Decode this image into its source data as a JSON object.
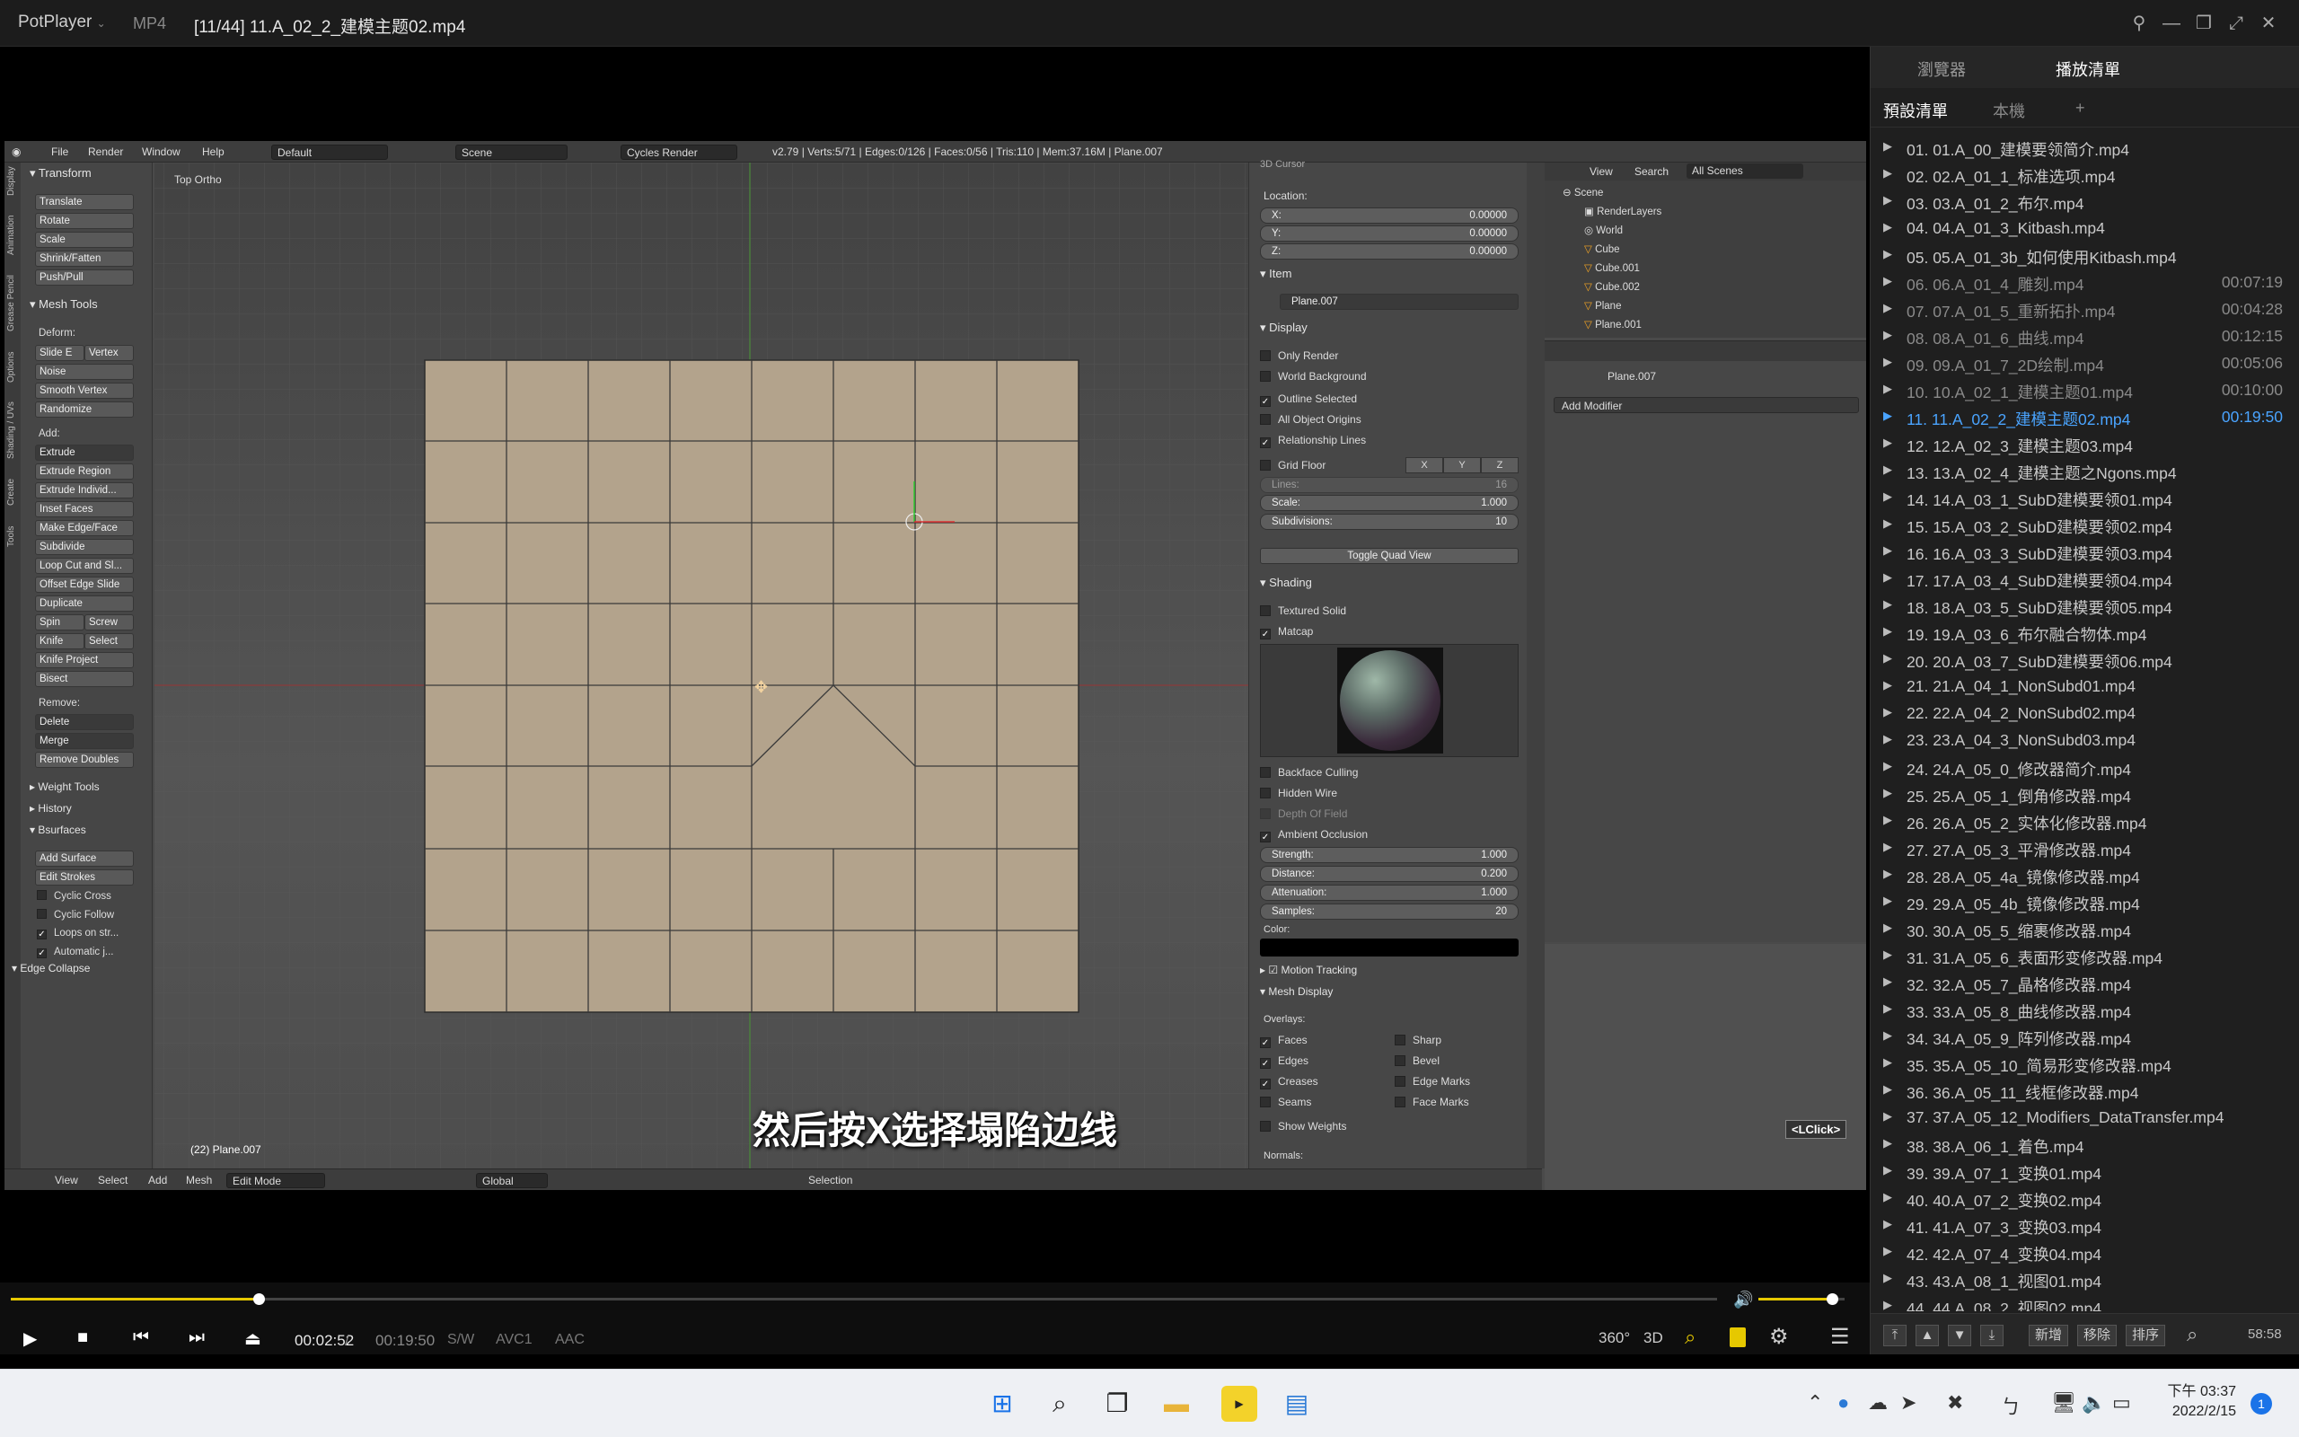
{
  "titlebar": {
    "app_name": "PotPlayer",
    "format": "MP4",
    "file_title": "[11/44] 11.A_02_2_建模主题02.mp4"
  },
  "blender": {
    "info_bar": {
      "menus": [
        "File",
        "Render",
        "Window",
        "Help"
      ],
      "layout": "Default",
      "scene": "Scene",
      "engine": "Cycles Render",
      "stats": "v2.79 | Verts:5/71 | Edges:0/126 | Faces:0/56 | Tris:110 | Mem:37.16M | Plane.007"
    },
    "toolshelf": {
      "transform_title": "Transform",
      "transform_buttons": [
        "Translate",
        "Rotate",
        "Scale",
        "Shrink/Fatten",
        "Push/Pull"
      ],
      "mesh_tools_title": "Mesh Tools",
      "deform_label": "Deform:",
      "slide_edge": "Slide E",
      "vertex": "Vertex",
      "deform_buttons": [
        "Noise",
        "Smooth Vertex",
        "Randomize"
      ],
      "add_label": "Add:",
      "extrude": "Extrude",
      "add_buttons": [
        "Extrude Region",
        "Extrude Individ...",
        "Inset Faces",
        "Make Edge/Face",
        "Subdivide",
        "Loop Cut and Sl...",
        "Offset Edge Slide",
        "Duplicate"
      ],
      "spin": "Spin",
      "screw": "Screw",
      "knife": "Knife",
      "select": "Select",
      "knife_project": "Knife Project",
      "bisect": "Bisect",
      "remove_label": "Remove:",
      "delete": "Delete",
      "merge": "Merge",
      "remove_doubles": "Remove Doubles",
      "weight_tools": "Weight Tools",
      "history": "History",
      "bsurfaces": "Bsurfaces",
      "add_surface": "Add Surface",
      "edit_strokes": "Edit Strokes",
      "cyclic_cross": "Cyclic Cross",
      "cyclic_follow": "Cyclic Follow",
      "loops_on_strokes": "Loops on str...",
      "automatic": "Automatic j...",
      "edge_collapse": "Edge Collapse",
      "vtabs": [
        "Tools",
        "Create",
        "Shading / UVs",
        "Options",
        "Grease Pencil",
        "Animation",
        "Display"
      ]
    },
    "viewport": {
      "view_label": "Top Ortho",
      "object_label": "(22) Plane.007"
    },
    "npanel": {
      "cursor_title": "3D Cursor",
      "location_label": "Location:",
      "x": {
        "label": "X:",
        "value": "0.00000"
      },
      "y": {
        "label": "Y:",
        "value": "0.00000"
      },
      "z": {
        "label": "Z:",
        "value": "0.00000"
      },
      "item_title": "Item",
      "item_name": "Plane.007",
      "display_title": "Display",
      "only_render": "Only Render",
      "world_background": "World Background",
      "outline_selected": "Outline Selected",
      "all_object_origins": "All Object Origins",
      "relationship_lines": "Relationship Lines",
      "grid_floor": "Grid Floor",
      "gx": "X",
      "gy": "Y",
      "gz": "Z",
      "lines": {
        "label": "Lines:",
        "value": "16"
      },
      "scale": {
        "label": "Scale:",
        "value": "1.000"
      },
      "subdivisions": {
        "label": "Subdivisions:",
        "value": "10"
      },
      "toggle_quad": "Toggle Quad View",
      "shading_title": "Shading",
      "textured_solid": "Textured Solid",
      "matcap": "Matcap",
      "backface_culling": "Backface Culling",
      "hidden_wire": "Hidden Wire",
      "depth_of_field": "Depth Of Field",
      "ambient_occlusion": "Ambient Occlusion",
      "strength": {
        "label": "Strength:",
        "value": "1.000"
      },
      "distance": {
        "label": "Distance:",
        "value": "0.200"
      },
      "attenuation": {
        "label": "Attenuation:",
        "value": "1.000"
      },
      "samples": {
        "label": "Samples:",
        "value": "20"
      },
      "color_label": "Color:",
      "motion_tracking": "Motion Tracking",
      "mesh_display": "Mesh Display",
      "overlays": "Overlays:",
      "faces": "Faces",
      "sharp": "Sharp",
      "edges": "Edges",
      "bevel": "Bevel",
      "creases": "Creases",
      "edge_marks": "Edge Marks",
      "seams": "Seams",
      "face_marks": "Face Marks",
      "show_weights": "Show Weights",
      "normals": "Normals:"
    },
    "outliner": {
      "view": "View",
      "search": "Search",
      "filter": "All Scenes",
      "items": [
        "Scene",
        "RenderLayers",
        "World",
        "Cube",
        "Cube.001",
        "Cube.002",
        "Plane",
        "Plane.001"
      ]
    },
    "properties": {
      "object": "Plane.007",
      "add_modifier": "Add Modifier"
    },
    "lower": {
      "lclick": "<LClick>"
    },
    "bottom_bar": {
      "menus": [
        "View",
        "Select",
        "Add",
        "Mesh"
      ],
      "mode": "Edit Mode",
      "orientation": "Global",
      "selection": "Selection"
    }
  },
  "subtitle": "然后按X选择塌陷边线",
  "player": {
    "current_time": "00:02:52",
    "separator": "/",
    "duration": "00:19:50",
    "codecs": [
      "S/W",
      "AVC1",
      "AAC"
    ],
    "right_buttons": [
      "360°",
      "3D"
    ],
    "progress_fraction": 0.145,
    "volume_fraction": 0.85
  },
  "playlist": {
    "tabs": [
      "瀏覽器",
      "播放清單"
    ],
    "subtabs": [
      "預設清單",
      "本機",
      "+"
    ],
    "active_index": 10,
    "items": [
      {
        "name": "01. 01.A_00_建模要领简介.mp4",
        "duration": ""
      },
      {
        "name": "02. 02.A_01_1_标准选项.mp4",
        "duration": ""
      },
      {
        "name": "03. 03.A_01_2_布尔.mp4",
        "duration": ""
      },
      {
        "name": "04. 04.A_01_3_Kitbash.mp4",
        "duration": ""
      },
      {
        "name": "05. 05.A_01_3b_如何使用Kitbash.mp4",
        "duration": ""
      },
      {
        "name": "06. 06.A_01_4_雕刻.mp4",
        "duration": "00:07:19"
      },
      {
        "name": "07. 07.A_01_5_重新拓扑.mp4",
        "duration": "00:04:28"
      },
      {
        "name": "08. 08.A_01_6_曲线.mp4",
        "duration": "00:12:15"
      },
      {
        "name": "09. 09.A_01_7_2D绘制.mp4",
        "duration": "00:05:06"
      },
      {
        "name": "10. 10.A_02_1_建模主题01.mp4",
        "duration": "00:10:00"
      },
      {
        "name": "11. 11.A_02_2_建模主题02.mp4",
        "duration": "00:19:50"
      },
      {
        "name": "12. 12.A_02_3_建模主题03.mp4",
        "duration": ""
      },
      {
        "name": "13. 13.A_02_4_建模主题之Ngons.mp4",
        "duration": ""
      },
      {
        "name": "14. 14.A_03_1_SubD建模要领01.mp4",
        "duration": ""
      },
      {
        "name": "15. 15.A_03_2_SubD建模要领02.mp4",
        "duration": ""
      },
      {
        "name": "16. 16.A_03_3_SubD建模要领03.mp4",
        "duration": ""
      },
      {
        "name": "17. 17.A_03_4_SubD建模要领04.mp4",
        "duration": ""
      },
      {
        "name": "18. 18.A_03_5_SubD建模要领05.mp4",
        "duration": ""
      },
      {
        "name": "19. 19.A_03_6_布尔融合物体.mp4",
        "duration": ""
      },
      {
        "name": "20. 20.A_03_7_SubD建模要领06.mp4",
        "duration": ""
      },
      {
        "name": "21. 21.A_04_1_NonSubd01.mp4",
        "duration": ""
      },
      {
        "name": "22. 22.A_04_2_NonSubd02.mp4",
        "duration": ""
      },
      {
        "name": "23. 23.A_04_3_NonSubd03.mp4",
        "duration": ""
      },
      {
        "name": "24. 24.A_05_0_修改器简介.mp4",
        "duration": ""
      },
      {
        "name": "25. 25.A_05_1_倒角修改器.mp4",
        "duration": ""
      },
      {
        "name": "26. 26.A_05_2_实体化修改器.mp4",
        "duration": ""
      },
      {
        "name": "27. 27.A_05_3_平滑修改器.mp4",
        "duration": ""
      },
      {
        "name": "28. 28.A_05_4a_镜像修改器.mp4",
        "duration": ""
      },
      {
        "name": "29. 29.A_05_4b_镜像修改器.mp4",
        "duration": ""
      },
      {
        "name": "30. 30.A_05_5_缩裹修改器.mp4",
        "duration": ""
      },
      {
        "name": "31. 31.A_05_6_表面形变修改器.mp4",
        "duration": ""
      },
      {
        "name": "32. 32.A_05_7_晶格修改器.mp4",
        "duration": ""
      },
      {
        "name": "33. 33.A_05_8_曲线修改器.mp4",
        "duration": ""
      },
      {
        "name": "34. 34.A_05_9_阵列修改器.mp4",
        "duration": ""
      },
      {
        "name": "35. 35.A_05_10_简易形变修改器.mp4",
        "duration": ""
      },
      {
        "name": "36. 36.A_05_11_线框修改器.mp4",
        "duration": ""
      },
      {
        "name": "37. 37.A_05_12_Modifiers_DataTransfer.mp4",
        "duration": ""
      },
      {
        "name": "38. 38.A_06_1_着色.mp4",
        "duration": ""
      },
      {
        "name": "39. 39.A_07_1_变换01.mp4",
        "duration": ""
      },
      {
        "name": "40. 40.A_07_2_变换02.mp4",
        "duration": ""
      },
      {
        "name": "41. 41.A_07_3_变换03.mp4",
        "duration": ""
      },
      {
        "name": "42. 42.A_07_4_变换04.mp4",
        "duration": ""
      },
      {
        "name": "43. 43.A_08_1_视图01.mp4",
        "duration": ""
      },
      {
        "name": "44. 44.A_08_2_视图02.mp4",
        "duration": ""
      }
    ],
    "footer": {
      "new": "新增",
      "remove": "移除",
      "sort": "排序",
      "total_time": "58:58"
    }
  },
  "taskbar": {
    "time": "下午 03:37",
    "date": "2022/2/15",
    "notification_count": "1"
  }
}
